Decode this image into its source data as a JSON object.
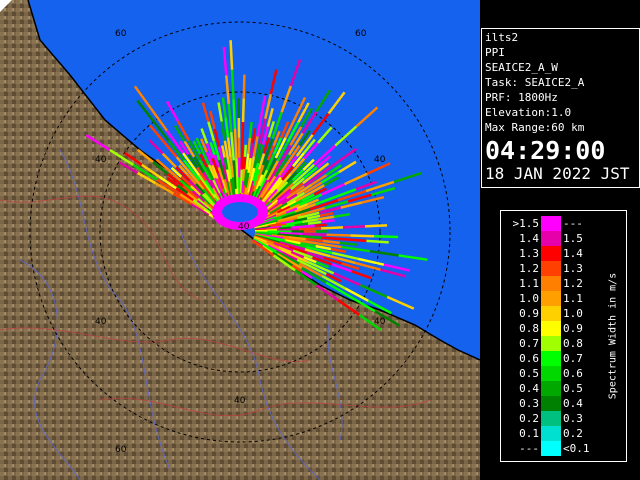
{
  "info": {
    "radar": "ilts2",
    "mode": "PPI",
    "scan": "SEAICE2_A_W",
    "task": "Task: SEAICE2_A",
    "prf": "PRF: 1800Hz",
    "elevation": "Elevation:1.0",
    "max_range": "Max Range:60 km",
    "time": "04:29:00",
    "date": "18 JAN 2022 JST"
  },
  "legend": {
    "unit": "Spectrum Width in m/s",
    "left_labels": [
      ">1.5",
      "1.4",
      "1.3",
      "1.2",
      "1.1",
      "1.0",
      "0.9",
      "0.8",
      "0.7",
      "0.6",
      "0.5",
      "0.4",
      "0.3",
      "0.2",
      "0.1",
      "---"
    ],
    "right_labels": [
      "---",
      "1.5",
      "1.4",
      "1.3",
      "1.2",
      "1.1",
      "1.0",
      "0.9",
      "0.8",
      "0.7",
      "0.6",
      "0.5",
      "0.4",
      "0.3",
      "0.2",
      "<0.1"
    ],
    "colors": [
      "#ff00ff",
      "#e600aa",
      "#ff0000",
      "#ff4000",
      "#ff8000",
      "#ffa000",
      "#ffd000",
      "#ffff00",
      "#a0ff00",
      "#00ff00",
      "#00d800",
      "#00a800",
      "#008000",
      "#00c080",
      "#00e0d0",
      "#00ffff"
    ]
  },
  "map": {
    "ring_labels": [
      "60",
      "60",
      "40",
      "40",
      "40",
      "40",
      "40",
      "40",
      "60"
    ],
    "sea_color": "#1560f0",
    "land_color": "#7a6545"
  }
}
